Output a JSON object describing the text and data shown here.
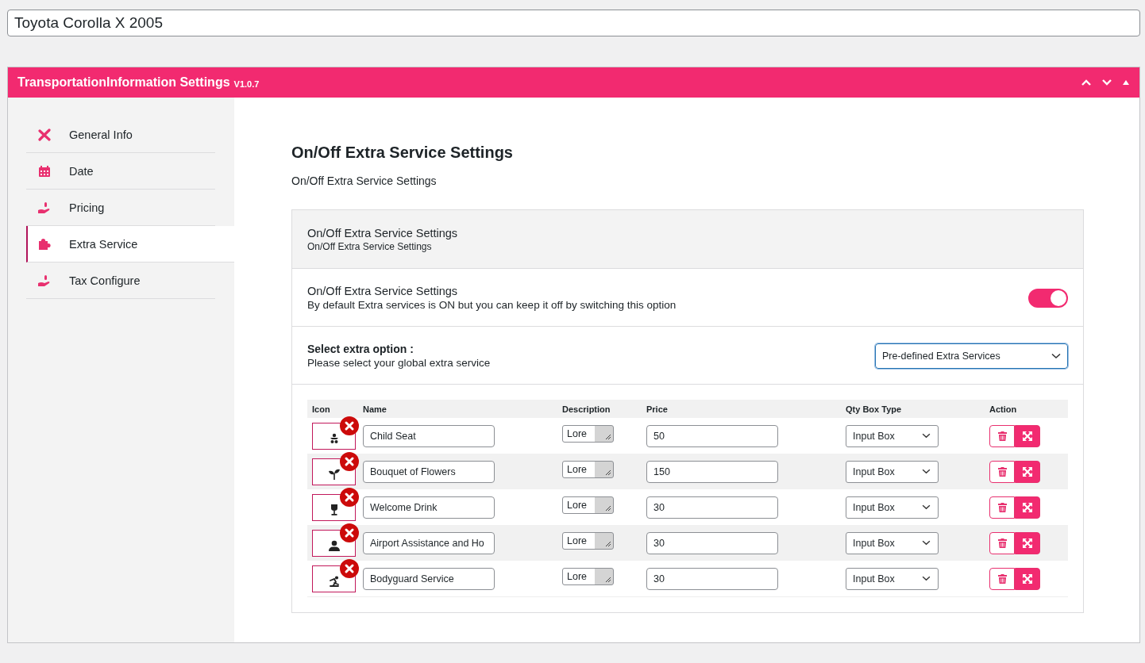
{
  "title_field": {
    "value": "Toyota Corolla X 2005"
  },
  "panel": {
    "title": "TransportationInformation Settings",
    "version": "V1.0.7"
  },
  "sidebar": {
    "items": [
      {
        "label": "General Info",
        "selected": false
      },
      {
        "label": "Date",
        "selected": false
      },
      {
        "label": "Pricing",
        "selected": false
      },
      {
        "label": "Extra Service",
        "selected": true
      },
      {
        "label": "Tax Configure",
        "selected": false
      }
    ]
  },
  "content": {
    "heading": "On/Off Extra Service Settings",
    "subheading": "On/Off Extra Service Settings",
    "box_header": {
      "title": "On/Off Extra Service Settings",
      "subtitle": "On/Off Extra Service Settings"
    },
    "toggle_row": {
      "title": "On/Off Extra Service Settings",
      "description": "By default Extra services is ON but you can keep it off by switching this option",
      "on": true
    },
    "select_row": {
      "title": "Select extra option :",
      "description": "Please select your global extra service",
      "value": "Pre-defined Extra Services"
    },
    "table": {
      "columns": [
        "Icon",
        "Name",
        "Description",
        "Price",
        "Qty Box Type",
        "Action"
      ],
      "rows": [
        {
          "name": "Child Seat",
          "description": "Lore",
          "price": "50",
          "qty_type": "Input Box"
        },
        {
          "name": "Bouquet of Flowers",
          "description": "Lore",
          "price": "150",
          "qty_type": "Input Box"
        },
        {
          "name": "Welcome Drink",
          "description": "Lore",
          "price": "30",
          "qty_type": "Input Box"
        },
        {
          "name": "Airport Assistance and Ho",
          "description": "Lore",
          "price": "30",
          "qty_type": "Input Box"
        },
        {
          "name": "Bodyguard Service",
          "description": "Lore",
          "price": "30",
          "qty_type": "Input Box"
        }
      ]
    }
  }
}
